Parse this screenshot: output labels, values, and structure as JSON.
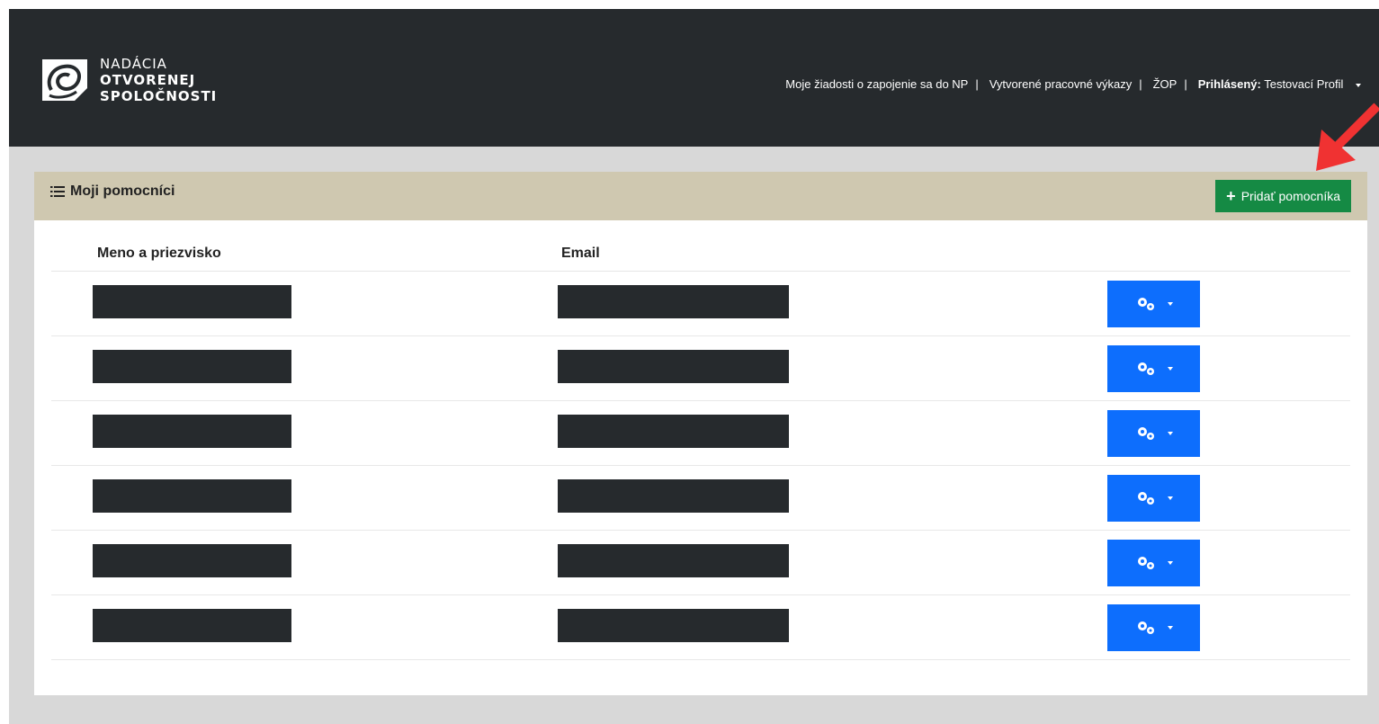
{
  "brand": {
    "line1": "NADÁCIA",
    "line2": "OTVORENEJ",
    "line3": "SPOLOČNOSTI"
  },
  "nav": {
    "items": [
      {
        "label": "Moje žiadosti o zapojenie sa do NP"
      },
      {
        "label": "Vytvorené pracovné výkazy"
      },
      {
        "label": "ŽOP"
      }
    ],
    "separator": "|",
    "user_prefix": "Prihlásený:",
    "user_name": "Testovací Profil"
  },
  "panel": {
    "title": "Moji pomocníci",
    "add_button_label": "Pridať pomocníka"
  },
  "table": {
    "columns": [
      "Meno a priezvisko",
      "Email"
    ],
    "row_count": 6
  },
  "colors": {
    "topbar": "#262a2d",
    "panel_header": "#cfc8b0",
    "add_button": "#158a44",
    "action_button": "#0d6efd",
    "annotation_arrow": "#f03232"
  }
}
